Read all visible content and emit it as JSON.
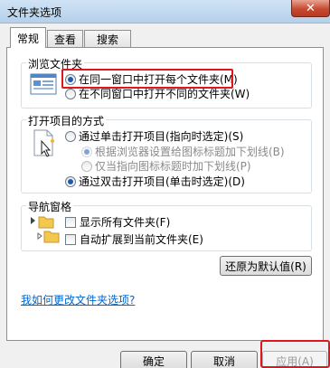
{
  "window": {
    "title": "文件夹选项",
    "close_glyph": "✕"
  },
  "tabs": [
    {
      "label": "常规",
      "active": true
    },
    {
      "label": "查看",
      "active": false
    },
    {
      "label": "搜索",
      "active": false
    }
  ],
  "browse_folders": {
    "title": "浏览文件夹",
    "options": [
      {
        "label": "在同一窗口中打开每个文件夹(M)",
        "checked": true
      },
      {
        "label": "在不同窗口中打开不同的文件夹(W)",
        "checked": false
      }
    ]
  },
  "click_items": {
    "title": "打开项目的方式",
    "single_click": {
      "label": "通过单击打开项目(指向时选定)(S)",
      "checked": false
    },
    "sub_options": [
      {
        "label": "根据浏览器设置给图标标题加下划线(B)",
        "checked": true
      },
      {
        "label": "仅当指向图标标题时加下划线(P)",
        "checked": false
      }
    ],
    "double_click": {
      "label": "通过双击打开项目(单击时选定)(D)",
      "checked": true
    }
  },
  "navigation_pane": {
    "title": "导航窗格",
    "options": [
      {
        "label": "显示所有文件夹(F)",
        "checked": false
      },
      {
        "label": "自动扩展到当前文件夹(E)",
        "checked": false
      }
    ]
  },
  "restore_defaults_label": "还原为默认值(R)",
  "help_link": "我如何更改文件夹选项?",
  "buttons": {
    "ok": "确定",
    "cancel": "取消",
    "apply": "应用(A)"
  },
  "colors": {
    "highlight": "#e0151d",
    "link": "#0066cc",
    "titlebar": "#b6d0ea"
  }
}
